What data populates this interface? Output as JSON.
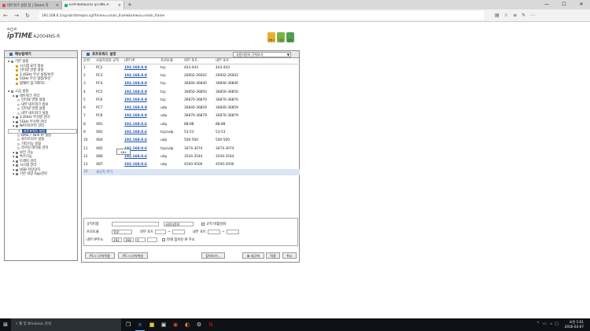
{
  "browser": {
    "tabs": [
      {
        "label": "네트워크 설정 팁 | Daum 카",
        "active": false
      },
      {
        "label": "EFM Networks ipTIME A",
        "active": true
      }
    ],
    "new_tab": "+",
    "url": "192.168.0.1/cgi-bin/timepro.cgi?tmenu=main_frame&smenu=main_frame",
    "window_buttons": [
      "—",
      "☐",
      "✕"
    ]
  },
  "router": {
    "brand_top": "ᄆ〇ᄆ",
    "brand": "ipTIME",
    "model": "A2004NS-R",
    "top_icons": [
      {
        "label": "마법사",
        "color": "#e8b030"
      },
      {
        "label": "기본",
        "color": "#7ab040"
      },
      {
        "label": "관리",
        "color": "#50a050"
      }
    ]
  },
  "sidebar": {
    "title": "메뉴탐색기",
    "items": [
      {
        "label": "기본 설정",
        "level": 0,
        "color": "#888"
      },
      {
        "label": "시스템 요약 정보",
        "level": 1,
        "color": "#d4a017"
      },
      {
        "label": "인터넷 연결 설정",
        "level": 1,
        "color": "#d4a017"
      },
      {
        "label": "2.4GHz 무선 설정/보안",
        "level": 1,
        "color": "#d4a017"
      },
      {
        "label": "5GHz 무선 설정/보안",
        "level": 1,
        "color": "#d4a017"
      },
      {
        "label": "펌웨어 업그레이드",
        "level": 1,
        "color": "#d4a017"
      },
      {
        "label": "",
        "level": -1,
        "color": ""
      },
      {
        "label": "고급 설정",
        "level": 0,
        "color": "#888"
      },
      {
        "label": "네트워크 관리",
        "level": 1,
        "color": "#777"
      },
      {
        "label": "인터넷 연결 설정",
        "level": 2,
        "color": "#ccc"
      },
      {
        "label": "내부 네트워크 정보",
        "level": 2,
        "color": "#ccc"
      },
      {
        "label": "인터넷 연결 설정",
        "level": 2,
        "color": "#ccc"
      },
      {
        "label": "내부 네트워크 설정",
        "level": 2,
        "color": "#ccc"
      },
      {
        "label": "2.4GHz 무선랜 관리",
        "level": 1,
        "color": "#777"
      },
      {
        "label": "5GHz 무선랜 관리",
        "level": 1,
        "color": "#777"
      },
      {
        "label": "NAT/라우터 관리",
        "level": 1,
        "color": "#777"
      },
      {
        "label": "포트포워드 설정",
        "level": 2,
        "color": "#ccc",
        "selected": true
      },
      {
        "label": "DMZ / Twin IP 설정",
        "level": 2,
        "color": "#ccc"
      },
      {
        "label": "포트트리거 설정",
        "level": 2,
        "color": "#ccc"
      },
      {
        "label": "기타기능 설정",
        "level": 2,
        "color": "#ccc"
      },
      {
        "label": "라우팅 테이블 관리",
        "level": 2,
        "color": "#ccc"
      },
      {
        "label": "보안 기능",
        "level": 1,
        "color": "#777"
      },
      {
        "label": "특수기능",
        "level": 1,
        "color": "#777"
      },
      {
        "label": "트래픽 관리",
        "level": 1,
        "color": "#777"
      },
      {
        "label": "시스템 관리",
        "level": 1,
        "color": "#777"
      },
      {
        "label": "USB 저장장치",
        "level": 1,
        "color": "#777"
      },
      {
        "label": "기본 내장 App관리",
        "level": 1,
        "color": "#777"
      }
    ]
  },
  "panel": {
    "title": "포트포워드 설정",
    "view_select": "사용자정의 규칙보기",
    "columns": [
      "순위",
      "사용자정의 규칙",
      "내부 IP",
      "프로토콜",
      "외부 포트",
      "내부 포트"
    ],
    "rows": [
      [
        "1",
        "PC2",
        "192.168.0.9",
        "tcp",
        "443-443",
        "443-443"
      ],
      [
        "2",
        "PC3",
        "192.168.0.9",
        "tcp",
        "26002-26002",
        "26002-26002"
      ],
      [
        "3",
        "PC4",
        "192.168.0.9",
        "tcp",
        "36840-36840",
        "36840-36840"
      ],
      [
        "4",
        "PC5",
        "192.168.0.9",
        "tcp",
        "36850-36850",
        "36850-36850"
      ],
      [
        "5",
        "PC6",
        "192.168.0.9",
        "tcp",
        "36870-36870",
        "36870-36870"
      ],
      [
        "6",
        "PC7",
        "192.168.0.9",
        "udp",
        "36840-36859",
        "36840-36859"
      ],
      [
        "7",
        "PC8",
        "192.168.0.9",
        "udp",
        "36870-36879",
        "36870-36879"
      ],
      [
        "8",
        "XB1",
        "192.168.0.6",
        "udp",
        "88-88",
        "88-88"
      ],
      [
        "9",
        "XB2",
        "192.168.0.6",
        "tcp/udp",
        "53-53",
        "53-53"
      ],
      [
        "10",
        "XB4",
        "192.168.0.6",
        "udp",
        "500-500",
        "500-500"
      ],
      [
        "11",
        "XB5",
        "192.168.0.6",
        "tcp/udp",
        "3074-3074",
        "3074-3074"
      ],
      [
        "12",
        "XB6",
        "192.168.0.6",
        "udp",
        "3544-3544",
        "3544-3544"
      ],
      [
        "13",
        "XB7",
        "192.168.0.6",
        "udp",
        "4500-4500",
        "4500-4500"
      ]
    ],
    "add_row": {
      "num": "14",
      "label": "새규칙 추가"
    },
    "tooltip": "XB4",
    "form": {
      "rule_name_label": "규칙이름",
      "rule_name_value": "",
      "custom_select": "사용자정의",
      "disable_rule_label": "규칙 비활성화",
      "protocol_label": "프로토콜",
      "protocol_value": "TCP",
      "ext_port_label": "외부 포트",
      "port_sep": "~",
      "int_port_label": "내부 포트",
      "int_ip_label": "내부 IP주소",
      "ip_parts": [
        "192",
        "168",
        "0",
        ""
      ],
      "current_ip_label": "현재 접속된 IP 주소"
    },
    "buttons": {
      "pc_to_rule": "PC<-규칙적용",
      "rule_to_pc": "PC->규칙복원",
      "search": "찾아보기...",
      "delete": "⊠ 새규칙",
      "apply": "적용",
      "cancel": "취소"
    }
  },
  "taskbar": {
    "search_placeholder": "웹 및 Windows 검색",
    "time": "오전 1:01",
    "date": "2016-03-07",
    "icons": [
      "task-view-icon",
      "edge-icon",
      "explorer-icon",
      "store-icon",
      "chrome-icon",
      "media-icon",
      "settings-icon",
      "netflix-icon"
    ]
  }
}
